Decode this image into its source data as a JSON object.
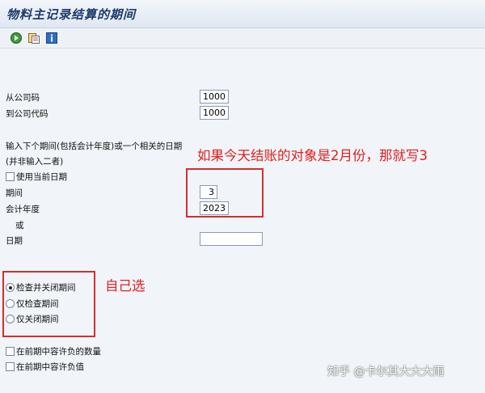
{
  "window": {
    "title": "物料主记录结算的期间"
  },
  "toolbar": {
    "icons": [
      "execute-icon",
      "variant-icon",
      "info-icon"
    ]
  },
  "form": {
    "from_company_label": "从公司码",
    "from_company_value": "1000",
    "to_company_label": "到公司代码",
    "to_company_value": "1000",
    "instruction_line1": "输入下个期间(包括会计年度)或一个相关的日期",
    "instruction_line2": "(并非输入二者)",
    "use_current_date_label": "使用当前日期",
    "use_current_date_checked": false,
    "period_label": "期间",
    "period_value": "3",
    "fiscal_year_label": "会计年度",
    "fiscal_year_value": "2023",
    "or_label": "或",
    "date_label": "日期",
    "date_value": ""
  },
  "options": {
    "radio_check_close": "检查并关闭期间",
    "radio_check_only": "仅检查期间",
    "radio_close_only": "仅关闭期间",
    "selected": "检查并关闭期间",
    "allow_negative_qty": "在前期中容许负的数量",
    "allow_negative_value": "在前期中容许负值"
  },
  "annotations": {
    "note_period": "如果今天结账的对象是2月份，那就写3",
    "note_choose": "自己选"
  },
  "watermark": "知乎 @卡尔其大大大雨",
  "colors": {
    "annotation_red": "#e02020",
    "title_blue": "#1e3a6b"
  }
}
